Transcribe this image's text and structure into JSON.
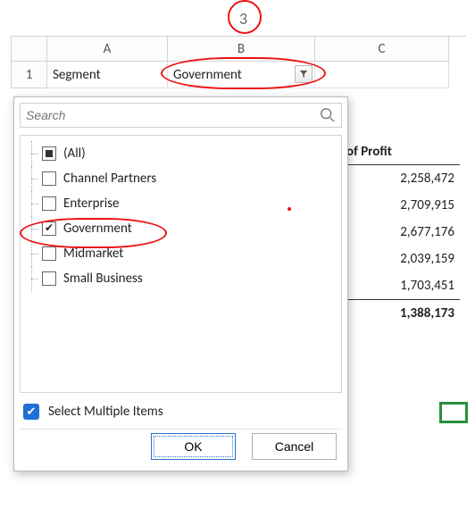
{
  "step_number": "3",
  "columns": {
    "A": "A",
    "B": "B",
    "C": "C"
  },
  "row1": "1",
  "cells": {
    "A1": "Segment",
    "B1": "Government"
  },
  "filter": {
    "search_placeholder": "Search",
    "items": [
      {
        "label": "(All)",
        "state": "mixed"
      },
      {
        "label": "Channel Partners",
        "state": "unchecked"
      },
      {
        "label": "Enterprise",
        "state": "unchecked"
      },
      {
        "label": "Government",
        "state": "checked"
      },
      {
        "label": "Midmarket",
        "state": "unchecked"
      },
      {
        "label": "Small Business",
        "state": "unchecked"
      }
    ],
    "select_multiple_label": "Select Multiple Items",
    "ok_label": "OK",
    "cancel_label": "Cancel"
  },
  "pivot": {
    "header": "of Profit",
    "values": [
      "2,258,472",
      "2,709,915",
      "2,677,176",
      "2,039,159",
      "1,703,451"
    ],
    "total": "1,388,173"
  }
}
